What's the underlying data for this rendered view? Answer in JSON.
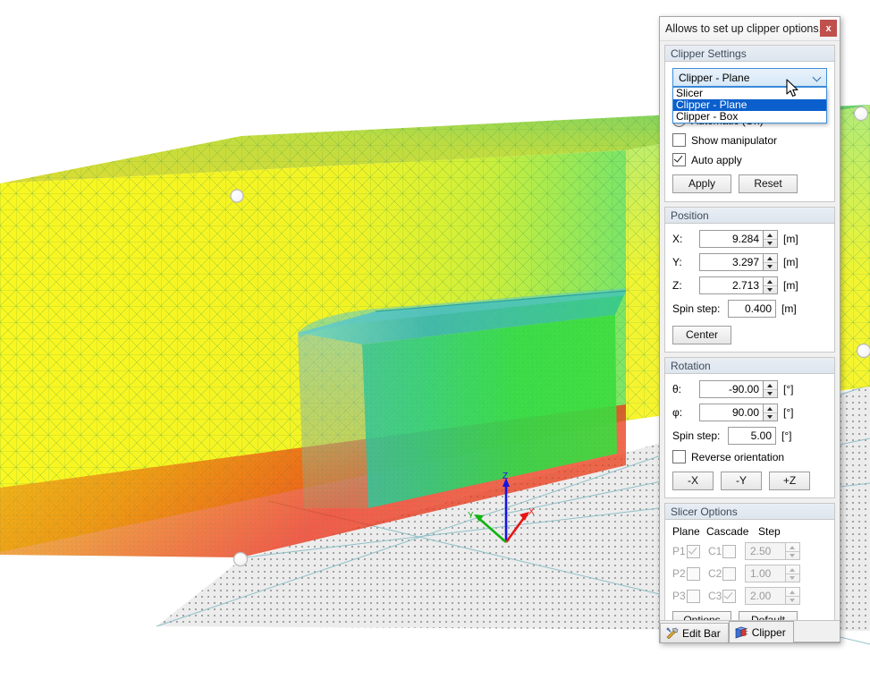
{
  "dialog": {
    "title": "Allows to set up clipper options.",
    "close_label": "x",
    "close_icon": "close-icon"
  },
  "clipper_settings": {
    "group_title": "Clipper Settings",
    "mode_combo": {
      "selected": "Clipper - Plane",
      "expanded": true,
      "options": [
        "Slicer",
        "Clipper - Plane",
        "Clipper - Box"
      ]
    },
    "automatic": {
      "label": "Automatic (On)",
      "checked": true
    },
    "show_manipulator": {
      "label": "Show manipulator",
      "checked": false
    },
    "auto_apply": {
      "label": "Auto apply",
      "checked": true
    },
    "apply_label": "Apply",
    "reset_label": "Reset"
  },
  "position": {
    "group_title": "Position",
    "x": {
      "label": "X:",
      "value": "9.284",
      "unit": "[m]"
    },
    "y": {
      "label": "Y:",
      "value": "3.297",
      "unit": "[m]"
    },
    "z": {
      "label": "Z:",
      "value": "2.713",
      "unit": "[m]"
    },
    "spin_step": {
      "label": "Spin step:",
      "value": "0.400",
      "unit": "[m]"
    },
    "center_label": "Center"
  },
  "rotation": {
    "group_title": "Rotation",
    "theta": {
      "label": "θ:",
      "value": "-90.00",
      "unit": "[°]"
    },
    "phi": {
      "label": "φ:",
      "value": "90.00",
      "unit": "[°]"
    },
    "spin_step": {
      "label": "Spin step:",
      "value": "5.00",
      "unit": "[°]"
    },
    "reverse_orientation": {
      "label": "Reverse orientation",
      "checked": false
    },
    "axis_buttons": [
      "-X",
      "-Y",
      "+Z"
    ]
  },
  "slicer_options": {
    "group_title": "Slicer Options",
    "enabled": false,
    "headers": [
      "Plane",
      "Cascade",
      "Step"
    ],
    "rows": [
      {
        "plane": "P1",
        "plane_checked": true,
        "cascade": "C1",
        "cascade_checked": false,
        "step": "2.50"
      },
      {
        "plane": "P2",
        "plane_checked": false,
        "cascade": "C2",
        "cascade_checked": false,
        "step": "1.00"
      },
      {
        "plane": "P3",
        "plane_checked": false,
        "cascade": "C3",
        "cascade_checked": true,
        "step": "2.00"
      }
    ],
    "options_label": "Options",
    "default_label": "Default"
  },
  "tabs": [
    {
      "label": "Edit Bar",
      "icon": "tools-icon",
      "active": false
    },
    {
      "label": "Clipper",
      "icon": "cube-icon",
      "active": true
    }
  ],
  "viewport": {
    "axis_triad": {
      "x_label": "X",
      "y_label": "Y",
      "z_label": "Z"
    },
    "colors": {
      "mesh_yellow": "#f7f317",
      "mesh_green": "#3be03b",
      "mesh_teal": "#2fb9a8",
      "mesh_orange": "#f6a020",
      "mesh_red": "#f02b1e",
      "wire_green": "#3f9a55",
      "ground": "#ececec",
      "grid_line": "#8fc4c8",
      "axis_x": "#e61414",
      "axis_y": "#11b411",
      "axis_z": "#1414e6",
      "handle": "#ffffff"
    }
  }
}
